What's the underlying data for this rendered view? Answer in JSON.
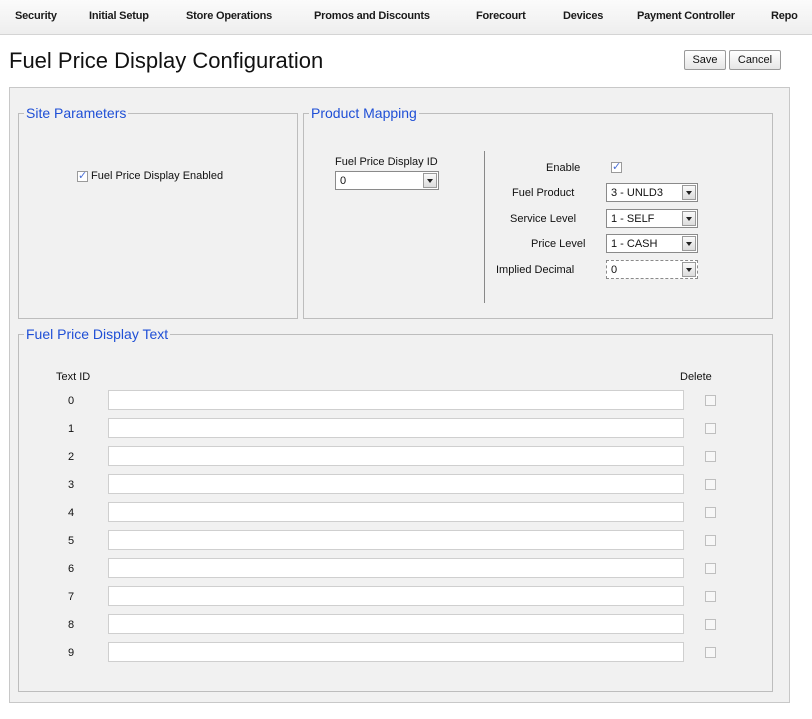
{
  "nav": {
    "items": [
      {
        "label": "Security"
      },
      {
        "label": "Initial Setup"
      },
      {
        "label": "Store Operations"
      },
      {
        "label": "Promos and Discounts"
      },
      {
        "label": "Forecourt"
      },
      {
        "label": "Devices"
      },
      {
        "label": "Payment Controller"
      },
      {
        "label": "Repo"
      }
    ]
  },
  "page": {
    "title": "Fuel Price Display Configuration"
  },
  "toolbar": {
    "save_label": "Save",
    "cancel_label": "Cancel"
  },
  "site_parameters": {
    "legend": "Site Parameters",
    "fpd_enabled_label": "Fuel Price Display Enabled",
    "fpd_enabled": true
  },
  "product_mapping": {
    "legend": "Product Mapping",
    "fpd_id_label": "Fuel Price Display ID",
    "fpd_id_value": "0",
    "enable_label": "Enable",
    "enable": true,
    "fuel_product_label": "Fuel Product",
    "fuel_product_value": "3 - UNLD3",
    "service_level_label": "Service Level",
    "service_level_value": "1 - SELF",
    "price_level_label": "Price Level",
    "price_level_value": "1 - CASH",
    "implied_decimal_label": "Implied Decimal",
    "implied_decimal_value": "0"
  },
  "display_text": {
    "legend": "Fuel Price Display Text",
    "col_text_id": "Text ID",
    "col_delete": "Delete",
    "rows": [
      {
        "id": "0",
        "text": ""
      },
      {
        "id": "1",
        "text": ""
      },
      {
        "id": "2",
        "text": ""
      },
      {
        "id": "3",
        "text": ""
      },
      {
        "id": "4",
        "text": ""
      },
      {
        "id": "5",
        "text": ""
      },
      {
        "id": "6",
        "text": ""
      },
      {
        "id": "7",
        "text": ""
      },
      {
        "id": "8",
        "text": ""
      },
      {
        "id": "9",
        "text": ""
      }
    ]
  },
  "colors": {
    "legend": "#1f4fd6",
    "panel_bg": "#f1f1f1"
  }
}
